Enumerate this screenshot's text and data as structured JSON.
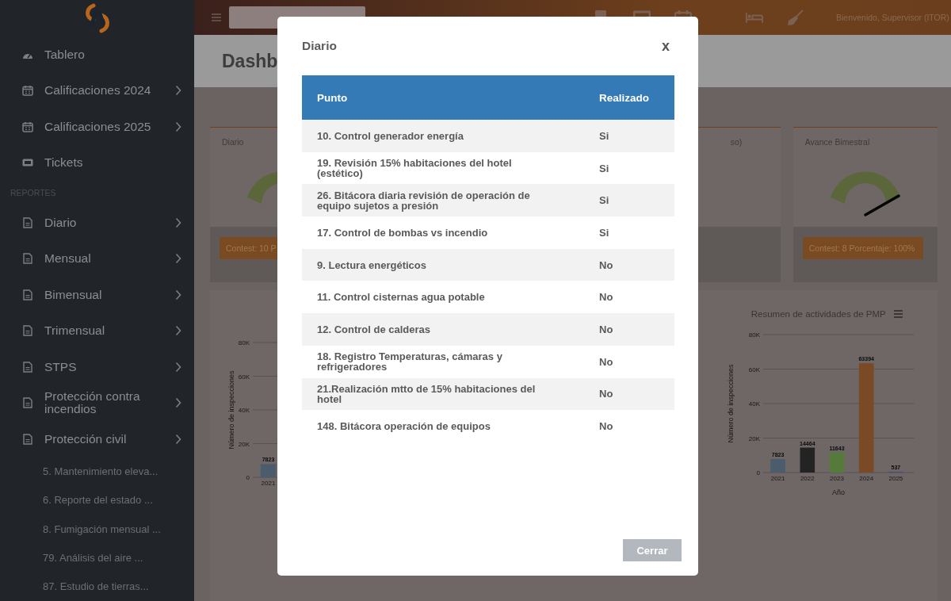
{
  "sidebar": {
    "items": [
      {
        "label": "Tablero",
        "kind": "dashboard",
        "expandable": false
      },
      {
        "label": "Calificaciones 2024",
        "kind": "calendar",
        "expandable": true
      },
      {
        "label": "Calificaciones 2025",
        "kind": "calendar",
        "expandable": true
      },
      {
        "label": "Tickets",
        "kind": "ticket",
        "expandable": false
      }
    ],
    "section_title": "REPORTES",
    "reports": [
      {
        "label": "Diario",
        "expandable": true
      },
      {
        "label": "Mensual",
        "expandable": true
      },
      {
        "label": "Bimensual",
        "expandable": true
      },
      {
        "label": "Trimensual",
        "expandable": true
      },
      {
        "label": "STPS",
        "expandable": true
      },
      {
        "label": "Protección contra incendios",
        "expandable": true
      },
      {
        "label": "Protección civil",
        "expandable": true
      }
    ],
    "sub_items": [
      "5. Mantenimiento eleva...",
      "6. Reporte del estado ...",
      "8. Fumigación mensual ...",
      "79. Análisis del aire ...",
      "87. Estudio de tierras..."
    ]
  },
  "top_bar": {
    "user": "Bienvenido, Supervisor (ITOR)"
  },
  "page_title": "Dashb",
  "cards": [
    {
      "title": "Diario",
      "button": "Contest: 10 P"
    },
    {
      "title": "so)"
    },
    {
      "title": "Avance Bimestral",
      "button": "Contest: 8 Porcentaje: 100%"
    }
  ],
  "chart_left": {
    "chart_data": {
      "type": "bar",
      "ylabel": "Número de inspecciones",
      "categories": [
        "2021"
      ],
      "series": [
        {
          "color": "#4b5c6c",
          "values": [
            7823
          ]
        }
      ],
      "ylim": [
        0,
        80000
      ],
      "yticks": [
        {
          "value": 0,
          "label": "0"
        },
        {
          "value": 20000,
          "label": "20K"
        },
        {
          "value": 40000,
          "label": "40K"
        },
        {
          "value": 60000,
          "label": "60K"
        },
        {
          "value": 80000,
          "label": "80K"
        }
      ],
      "grid": true,
      "data_labels": true
    }
  },
  "chart_right": {
    "chart_data": {
      "type": "bar",
      "title": "Resumen de actividades de PMP",
      "xlabel": "Año",
      "ylabel": "Número de inspecciones",
      "categories": [
        "2021",
        "2022",
        "2023",
        "2024",
        "2025"
      ],
      "series": [
        {
          "color": "#4b5c6c",
          "values": [
            7823,
            null,
            null,
            null,
            null
          ]
        },
        {
          "color": "#232323",
          "values": [
            null,
            14464,
            null,
            null,
            null
          ]
        },
        {
          "color": "#557a3a",
          "values": [
            null,
            null,
            11643,
            null,
            null
          ]
        },
        {
          "color": "#7a4a27",
          "values": [
            null,
            null,
            null,
            63394,
            null
          ]
        },
        {
          "color": "#4e4f78",
          "values": [
            null,
            null,
            null,
            null,
            537
          ]
        }
      ],
      "ylim": [
        0,
        80000
      ],
      "yticks": [
        {
          "value": 0,
          "label": "0"
        },
        {
          "value": 20000,
          "label": "20K"
        },
        {
          "value": 40000,
          "label": "40K"
        },
        {
          "value": 60000,
          "label": "60K"
        },
        {
          "value": 80000,
          "label": "80K"
        }
      ],
      "grid": true,
      "stacked": true,
      "data_labels": true
    }
  },
  "modal": {
    "title": "Diario",
    "close": "x",
    "columns": [
      "Punto",
      "Realizado"
    ],
    "rows": [
      [
        "10. Control generador energía",
        "Si"
      ],
      [
        "19. Revisión 15% habitaciones del hotel (estético)",
        "Si"
      ],
      [
        "26. Bitácora diaria revisión de operación de equipo sujetos a presión",
        "Si"
      ],
      [
        "17. Control de bombas vs incendio",
        "Si"
      ],
      [
        "9. Lectura energéticos",
        "No"
      ],
      [
        "11. Control cisternas agua potable",
        "No"
      ],
      [
        "12. Control de calderas",
        "No"
      ],
      [
        "18. Registro Temperaturas, cámaras y refrigeradores",
        "No"
      ],
      [
        "21.Realización mtto de 15% habitaciones del hotel",
        "No"
      ],
      [
        "148. Bitácora operación de equipos",
        "No"
      ]
    ],
    "button": "Cerrar"
  }
}
